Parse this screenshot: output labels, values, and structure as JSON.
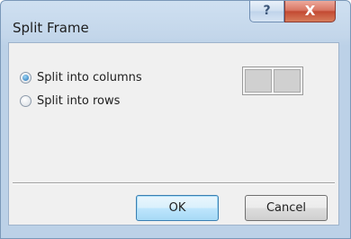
{
  "window": {
    "title": "Split Frame",
    "help_glyph": "?",
    "close_glyph": "X"
  },
  "options": [
    {
      "label": "Split into columns",
      "checked": true
    },
    {
      "label": "Split into rows",
      "checked": false
    }
  ],
  "preview": {
    "icon": "split-columns-preview-icon",
    "cells": 2
  },
  "buttons": {
    "ok_label": "OK",
    "cancel_label": "Cancel"
  },
  "colors": {
    "frame": "#bcd1e7",
    "client": "#f0f0f0",
    "close": "#c34a33",
    "accent": "#3c7fb1"
  }
}
